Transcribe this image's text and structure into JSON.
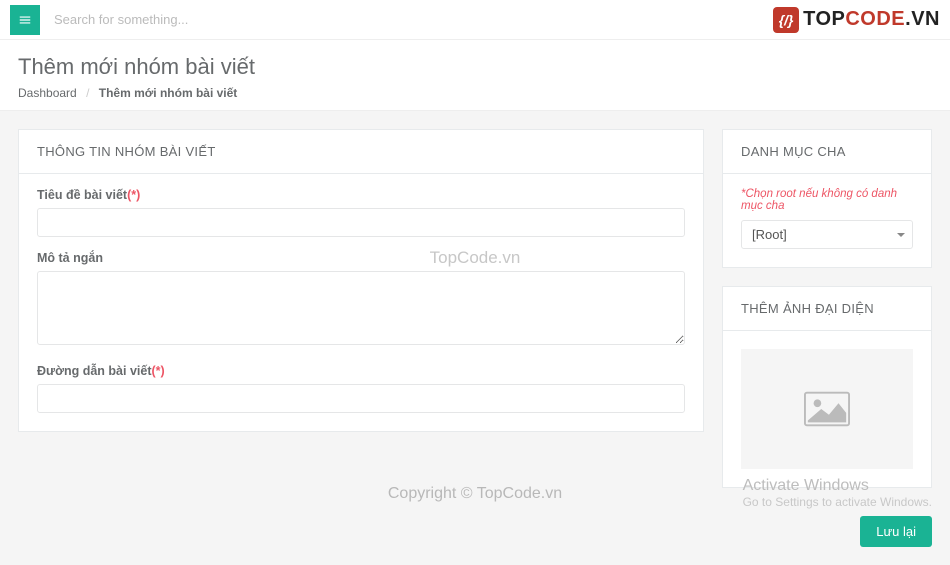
{
  "topbar": {
    "search_placeholder": "Search for something...",
    "logo_top": "TOP",
    "logo_code": "CODE",
    "logo_vn": ".VN",
    "logo_icon": "{/}"
  },
  "header": {
    "title": "Thêm mới nhóm bài viết",
    "breadcrumb_home": "Dashboard",
    "breadcrumb_sep": "/",
    "breadcrumb_current": "Thêm mới nhóm bài viết"
  },
  "main_panel": {
    "heading": "THÔNG TIN NHÓM BÀI VIẾT",
    "field_title_label": "Tiêu đề bài viết",
    "field_title_req": "(*)",
    "field_title_value": "",
    "field_desc_label": "Mô tả ngắn",
    "field_desc_value": "",
    "field_url_label": "Đường dẫn bài viết",
    "field_url_req": "(*)",
    "field_url_value": ""
  },
  "parent_panel": {
    "heading": "DANH MỤC CHA",
    "hint": "*Chọn root nếu không có danh mục cha",
    "selected": "[Root]"
  },
  "image_panel": {
    "heading": "THÊM ẢNH ĐẠI DIỆN"
  },
  "actions": {
    "save": "Lưu lại"
  },
  "watermarks": {
    "center": "TopCode.vn",
    "bottom": "Copyright © TopCode.vn",
    "activate_title": "Activate Windows",
    "activate_sub": "Go to Settings to activate Windows."
  }
}
